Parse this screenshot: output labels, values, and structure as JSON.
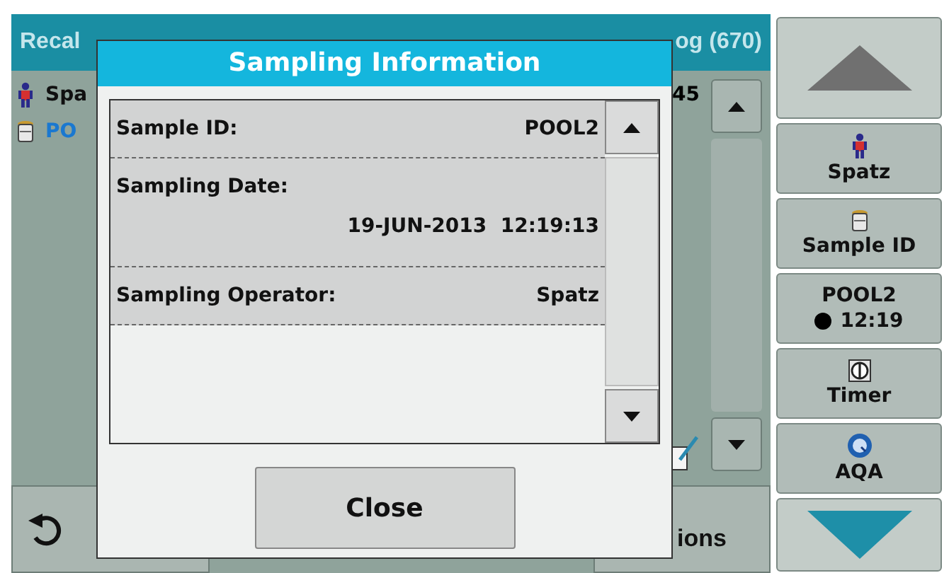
{
  "screen": {
    "title": "Recal",
    "subtitle": "og (670)",
    "rows": [
      {
        "kind": "person",
        "text": "Spa",
        "value": "45",
        "color": "#101010"
      },
      {
        "kind": "vial",
        "text": "PO",
        "color": "#1a78d0"
      }
    ],
    "bottom_buttons": [
      {
        "kind": "back"
      },
      {
        "kind": "label",
        "label": "ions"
      }
    ]
  },
  "side_buttons": [
    {
      "kind": "up"
    },
    {
      "kind": "person",
      "label": "Spatz"
    },
    {
      "kind": "vial",
      "label": "Sample ID"
    },
    {
      "kind": "sample",
      "label": "POOL2",
      "time": "12:19"
    },
    {
      "kind": "timer",
      "label": "Timer"
    },
    {
      "kind": "aqa",
      "label": "AQA"
    },
    {
      "kind": "down"
    }
  ],
  "dialog": {
    "title": "Sampling Information",
    "rows": [
      {
        "kind": "inline",
        "label": "Sample ID:",
        "value": "POOL2"
      },
      {
        "kind": "stacked",
        "label": "Sampling Date:",
        "value": "19-JUN-2013  12:19:13"
      },
      {
        "kind": "inline",
        "label": "Sampling Operator:",
        "value": "Spatz"
      }
    ],
    "button": "Close"
  }
}
